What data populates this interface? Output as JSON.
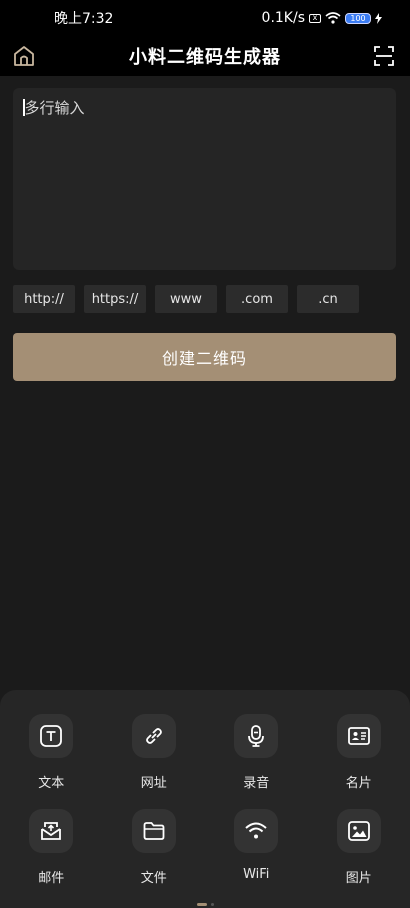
{
  "status_bar": {
    "time": "晚上7:32",
    "network_speed": "0.1K/s",
    "sim_icon": "x",
    "battery": "100"
  },
  "header": {
    "title": "小料二维码生成器",
    "home_icon": "home-icon",
    "scan_icon": "scan-icon"
  },
  "input": {
    "placeholder": "多行输入",
    "value": ""
  },
  "quick_inserts": [
    "http://",
    "https://",
    "www",
    ".com",
    ".cn"
  ],
  "create_button": {
    "label": "创建二维码"
  },
  "tools": [
    {
      "label": "文本",
      "icon": "text-icon"
    },
    {
      "label": "网址",
      "icon": "link-icon"
    },
    {
      "label": "录音",
      "icon": "microphone-icon"
    },
    {
      "label": "名片",
      "icon": "business-card-icon"
    },
    {
      "label": "邮件",
      "icon": "mail-icon"
    },
    {
      "label": "文件",
      "icon": "folder-icon"
    },
    {
      "label": "WiFi",
      "icon": "wifi-icon"
    },
    {
      "label": "图片",
      "icon": "image-icon"
    }
  ],
  "colors": {
    "accent": "#a48f75",
    "background": "#1b1b1b",
    "panel": "#262626"
  }
}
